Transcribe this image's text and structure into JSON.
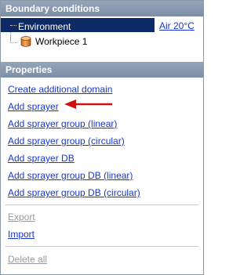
{
  "boundary_conditions": {
    "title": "Boundary conditions",
    "environment_label": "Environment",
    "environment_value": "Air 20°C",
    "workpiece_label": "Workpiece 1"
  },
  "properties": {
    "title": "Properties",
    "actions": [
      {
        "label": "Create additional domain",
        "enabled": true
      },
      {
        "label": "Add sprayer",
        "enabled": true
      },
      {
        "label": "Add sprayer group (linear)",
        "enabled": true
      },
      {
        "label": "Add sprayer group (circular)",
        "enabled": true
      },
      {
        "label": "Add sprayer DB",
        "enabled": true
      },
      {
        "label": "Add sprayer group DB (linear)",
        "enabled": true
      },
      {
        "label": "Add sprayer group DB (circular)",
        "enabled": true
      },
      {
        "label": "Export",
        "enabled": false
      },
      {
        "label": "Import",
        "enabled": true
      },
      {
        "label": "Delete all",
        "enabled": false
      }
    ]
  },
  "colors": {
    "header_bg": "#8595ac",
    "selection_bg": "#0e2a66",
    "link": "#1a37c9",
    "disabled": "#9a9a9a",
    "arrow": "#cc1111"
  },
  "icons": {
    "workpiece": "cylinder-icon",
    "pointer": "red-arrow-icon"
  }
}
